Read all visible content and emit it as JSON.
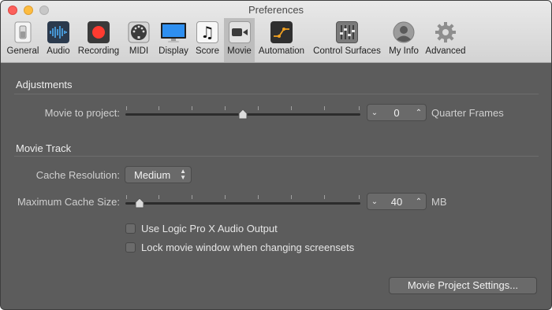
{
  "window": {
    "title": "Preferences"
  },
  "toolbar": {
    "items": [
      {
        "label": "General",
        "icon": "general-switch-icon"
      },
      {
        "label": "Audio",
        "icon": "audio-waveform-icon"
      },
      {
        "label": "Recording",
        "icon": "record-icon"
      },
      {
        "label": "MIDI",
        "icon": "midi-connector-icon"
      },
      {
        "label": "Display",
        "icon": "display-monitor-icon"
      },
      {
        "label": "Score",
        "icon": "music-note-icon"
      },
      {
        "label": "Movie",
        "icon": "movie-camera-icon",
        "selected": true
      },
      {
        "label": "Automation",
        "icon": "automation-curve-icon"
      },
      {
        "label": "Control Surfaces",
        "icon": "control-surfaces-faders-icon"
      },
      {
        "label": "My Info",
        "icon": "user-silhouette-icon"
      },
      {
        "label": "Advanced",
        "icon": "gear-icon"
      }
    ]
  },
  "adjustments": {
    "title": "Adjustments",
    "movie_to_project_label": "Movie to project:",
    "movie_to_project_value": "0",
    "movie_to_project_slider_fraction": 0.5,
    "unit": "Quarter Frames"
  },
  "movie_track": {
    "title": "Movie Track",
    "cache_resolution_label": "Cache Resolution:",
    "cache_resolution_value": "Medium",
    "max_cache_label": "Maximum Cache Size:",
    "max_cache_value": "40",
    "max_cache_slider_fraction": 0.06,
    "max_cache_unit": "MB",
    "checkbox_audio_output": "Use Logic Pro X Audio Output",
    "checkbox_audio_output_checked": false,
    "checkbox_lock_window": "Lock movie window when changing screensets",
    "checkbox_lock_window_checked": false,
    "project_settings_button": "Movie Project Settings..."
  },
  "colors": {
    "background": "#5c5c5c",
    "recording_red": "#ff3b30",
    "automation_yellow": "#f0a020"
  }
}
